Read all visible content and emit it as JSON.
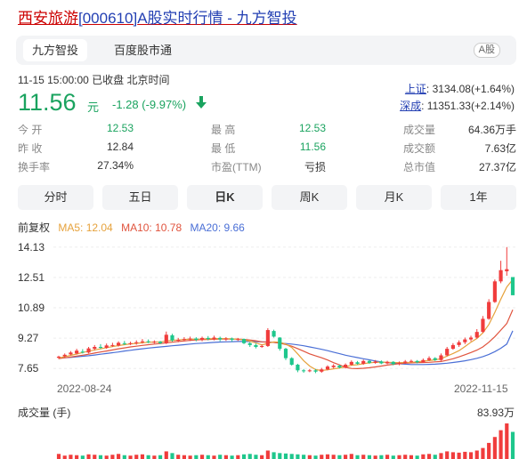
{
  "header": {
    "title_prefix": "西安旅游",
    "title_code": "[000610]",
    "title_suffix": "A股实时行情 - 九方智投"
  },
  "tabs": {
    "items": [
      "九方智投",
      "百度股市通"
    ],
    "active": 0,
    "badge": "A股"
  },
  "quote": {
    "status": "11-15 15:00:00  已收盘  北京时间",
    "price": "11.56",
    "unit": "元",
    "change": "-1.28 (-9.97%)",
    "direction": "down"
  },
  "indices": [
    {
      "name": "上证",
      "value": ": 3134.08(+1.64%)"
    },
    {
      "name": "深成",
      "value": ": 11351.33(+2.14%)"
    }
  ],
  "stats": {
    "col1": [
      {
        "label": "今    开",
        "value": "12.53",
        "green": true
      },
      {
        "label": "昨    收",
        "value": "12.84",
        "green": false
      },
      {
        "label": "换手率",
        "value": "27.34%",
        "green": false
      }
    ],
    "col2": [
      {
        "label": "最    高",
        "value": "12.53",
        "green": true
      },
      {
        "label": "最    低",
        "value": "11.56",
        "green": true
      },
      {
        "label": "市盈(TTM)",
        "value": "亏损",
        "green": false
      }
    ],
    "col3": [
      {
        "label": "成交量",
        "value": "64.36万手",
        "green": false
      },
      {
        "label": "成交额",
        "value": "7.63亿",
        "green": false
      },
      {
        "label": "总市值",
        "value": "27.37亿",
        "green": false
      }
    ]
  },
  "period_tabs": {
    "items": [
      "分时",
      "五日",
      "日K",
      "周K",
      "月K",
      "1年"
    ],
    "active": 2
  },
  "ma_legend": {
    "prefix": "前复权",
    "ma5": "MA5: 12.04",
    "ma10": "MA10: 10.78",
    "ma20": "MA20: 9.66"
  },
  "colors": {
    "up": "#f03c3c",
    "down": "#1ec78c",
    "ma5": "#e6a23c",
    "ma10": "#e0533d",
    "ma20": "#4a6fd6",
    "accent": "#2440b3",
    "title": "#cc0000"
  },
  "chart_data": {
    "type": "candlestick",
    "y_ticks": [
      "14.13",
      "12.51",
      "10.89",
      "9.27",
      "7.65"
    ],
    "ylim": [
      6.9,
      14.5
    ],
    "x_labels": [
      "2022-08-24",
      "2022-11-15"
    ],
    "volume_label": "成交量 (手)",
    "volume_max_label": "83.93万",
    "candles": [
      [
        8.22,
        8.28,
        8.33,
        8.15
      ],
      [
        8.3,
        8.38,
        8.45,
        8.25
      ],
      [
        8.4,
        8.5,
        8.58,
        8.35
      ],
      [
        8.45,
        8.6,
        8.7,
        8.4
      ],
      [
        8.55,
        8.5,
        8.68,
        8.45
      ],
      [
        8.5,
        8.72,
        8.8,
        8.45
      ],
      [
        8.7,
        8.8,
        8.9,
        8.62
      ],
      [
        8.8,
        8.75,
        8.95,
        8.7
      ],
      [
        8.75,
        8.88,
        8.98,
        8.7
      ],
      [
        8.85,
        8.9,
        9.02,
        8.8
      ],
      [
        8.88,
        9.02,
        9.1,
        8.82
      ],
      [
        9.0,
        8.95,
        9.12,
        8.9
      ],
      [
        8.95,
        9.0,
        9.08,
        8.9
      ],
      [
        9.0,
        9.05,
        9.15,
        8.92
      ],
      [
        9.05,
        9.1,
        9.22,
        8.98
      ],
      [
        9.1,
        9.05,
        9.2,
        9.0
      ],
      [
        9.05,
        9.08,
        9.15,
        8.98
      ],
      [
        9.08,
        9.0,
        9.12,
        8.95
      ],
      [
        9.0,
        9.45,
        9.62,
        8.95
      ],
      [
        9.42,
        9.15,
        9.5,
        9.08
      ],
      [
        9.15,
        9.18,
        9.28,
        9.05
      ],
      [
        9.18,
        9.22,
        9.32,
        9.1
      ],
      [
        9.2,
        9.25,
        9.35,
        9.12
      ],
      [
        9.25,
        9.18,
        9.32,
        9.1
      ],
      [
        9.18,
        9.28,
        9.35,
        9.1
      ],
      [
        9.28,
        9.22,
        9.38,
        9.15
      ],
      [
        9.22,
        9.3,
        9.4,
        9.15
      ],
      [
        9.28,
        9.2,
        9.35,
        9.1
      ],
      [
        9.2,
        9.25,
        9.32,
        9.12
      ],
      [
        9.25,
        9.18,
        9.3,
        9.08
      ],
      [
        9.18,
        9.22,
        9.28,
        9.12
      ],
      [
        9.22,
        9.0,
        9.25,
        8.95
      ],
      [
        9.0,
        8.9,
        9.05,
        8.8
      ],
      [
        8.9,
        8.8,
        8.98,
        8.72
      ],
      [
        8.8,
        8.85,
        8.92,
        8.75
      ],
      [
        8.85,
        9.7,
        9.8,
        8.8
      ],
      [
        9.65,
        9.35,
        9.72,
        9.3
      ],
      [
        9.3,
        8.7,
        9.32,
        8.6
      ],
      [
        8.7,
        8.2,
        8.75,
        8.1
      ],
      [
        8.2,
        7.85,
        8.25,
        7.8
      ],
      [
        7.85,
        7.55,
        7.9,
        7.45
      ],
      [
        7.55,
        7.5,
        7.62,
        7.42
      ],
      [
        7.5,
        7.55,
        7.62,
        7.45
      ],
      [
        7.55,
        7.48,
        7.62,
        7.4
      ],
      [
        7.48,
        7.6,
        7.68,
        7.42
      ],
      [
        7.6,
        7.75,
        7.82,
        7.55
      ],
      [
        7.72,
        7.8,
        7.88,
        7.65
      ],
      [
        7.8,
        7.7,
        7.85,
        7.65
      ],
      [
        7.7,
        7.85,
        7.92,
        7.65
      ],
      [
        7.85,
        8.0,
        8.08,
        7.8
      ],
      [
        7.98,
        7.9,
        8.05,
        7.85
      ],
      [
        7.9,
        8.05,
        8.12,
        7.85
      ],
      [
        8.05,
        7.95,
        8.1,
        7.9
      ],
      [
        7.95,
        8.02,
        8.1,
        7.9
      ],
      [
        8.02,
        7.92,
        8.08,
        7.88
      ],
      [
        7.92,
        8.0,
        8.06,
        7.88
      ],
      [
        8.0,
        7.88,
        8.04,
        7.82
      ],
      [
        7.88,
        7.95,
        8.02,
        7.82
      ],
      [
        7.95,
        8.02,
        8.1,
        7.9
      ],
      [
        8.02,
        8.05,
        8.12,
        7.95
      ],
      [
        8.05,
        7.98,
        8.1,
        7.92
      ],
      [
        7.98,
        8.1,
        8.18,
        7.95
      ],
      [
        8.1,
        8.2,
        8.3,
        8.05
      ],
      [
        8.2,
        8.1,
        8.25,
        8.05
      ],
      [
        8.1,
        8.35,
        8.45,
        8.05
      ],
      [
        8.35,
        8.7,
        8.8,
        8.3
      ],
      [
        8.7,
        8.9,
        9.0,
        8.65
      ],
      [
        8.9,
        9.05,
        9.15,
        8.8
      ],
      [
        9.05,
        9.2,
        9.3,
        8.95
      ],
      [
        9.2,
        9.3,
        9.4,
        9.1
      ],
      [
        9.3,
        9.6,
        9.75,
        9.25
      ],
      [
        9.6,
        10.3,
        10.45,
        9.55
      ],
      [
        10.3,
        11.2,
        11.35,
        10.25
      ],
      [
        11.2,
        12.3,
        12.4,
        11.15
      ],
      [
        12.3,
        12.9,
        13.4,
        12.2
      ],
      [
        12.84,
        12.95,
        14.13,
        12.6
      ],
      [
        12.53,
        11.56,
        12.53,
        11.56
      ]
    ],
    "ma5": [
      8.2,
      8.28,
      8.35,
      8.42,
      8.5,
      8.57,
      8.64,
      8.7,
      8.76,
      8.82,
      8.87,
      8.92,
      8.96,
      8.99,
      9.02,
      9.05,
      9.06,
      9.06,
      9.12,
      9.15,
      9.17,
      9.2,
      9.22,
      9.21,
      9.22,
      9.23,
      9.24,
      9.25,
      9.24,
      9.23,
      9.21,
      9.17,
      9.11,
      9.02,
      8.91,
      8.99,
      9.07,
      9.05,
      8.95,
      8.77,
      8.43,
      8.07,
      7.78,
      7.59,
      7.54,
      7.58,
      7.63,
      7.67,
      7.73,
      7.82,
      7.85,
      7.9,
      7.95,
      7.98,
      7.99,
      7.98,
      7.97,
      7.96,
      7.97,
      7.98,
      8.0,
      8.04,
      8.07,
      8.11,
      8.17,
      8.31,
      8.45,
      8.6,
      8.82,
      9.05,
      9.25,
      9.55,
      10.0,
      10.65,
      11.35,
      12.0,
      12.4
    ],
    "ma10": [
      8.18,
      8.22,
      8.26,
      8.31,
      8.36,
      8.41,
      8.47,
      8.53,
      8.58,
      8.64,
      8.7,
      8.75,
      8.8,
      8.84,
      8.88,
      8.92,
      8.95,
      8.98,
      9.02,
      9.05,
      9.09,
      9.12,
      9.15,
      9.17,
      9.19,
      9.2,
      9.21,
      9.22,
      9.22,
      9.22,
      9.22,
      9.2,
      9.17,
      9.13,
      9.07,
      9.05,
      9.04,
      9.0,
      8.93,
      8.84,
      8.71,
      8.57,
      8.43,
      8.32,
      8.22,
      8.1,
      7.96,
      7.84,
      7.71,
      7.65,
      7.64,
      7.66,
      7.69,
      7.73,
      7.78,
      7.83,
      7.87,
      7.9,
      7.93,
      7.95,
      7.96,
      7.97,
      7.98,
      8.0,
      8.02,
      8.09,
      8.17,
      8.27,
      8.38,
      8.5,
      8.63,
      8.8,
      9.05,
      9.35,
      9.7,
      10.05,
      10.78
    ],
    "ma20": [
      8.2,
      8.22,
      8.24,
      8.27,
      8.3,
      8.33,
      8.37,
      8.41,
      8.45,
      8.49,
      8.53,
      8.58,
      8.62,
      8.66,
      8.7,
      8.74,
      8.77,
      8.8,
      8.83,
      8.86,
      8.89,
      8.92,
      8.95,
      8.98,
      9.0,
      9.02,
      9.04,
      9.06,
      9.07,
      9.08,
      9.09,
      9.09,
      9.09,
      9.08,
      9.07,
      9.06,
      9.04,
      9.01,
      8.98,
      8.95,
      8.91,
      8.86,
      8.8,
      8.74,
      8.67,
      8.6,
      8.52,
      8.44,
      8.36,
      8.29,
      8.23,
      8.17,
      8.11,
      8.05,
      8.0,
      7.96,
      7.93,
      7.9,
      7.88,
      7.86,
      7.86,
      7.86,
      7.87,
      7.88,
      7.9,
      7.93,
      7.97,
      8.01,
      8.06,
      8.12,
      8.19,
      8.28,
      8.4,
      8.55,
      8.73,
      8.95,
      9.66
    ],
    "volumes": [
      12,
      8,
      10,
      9,
      8,
      11,
      10,
      9,
      8,
      10,
      12,
      9,
      8,
      10,
      11,
      9,
      8,
      9,
      18,
      14,
      10,
      9,
      8,
      9,
      10,
      9,
      8,
      10,
      9,
      8,
      9,
      11,
      12,
      10,
      9,
      20,
      16,
      14,
      13,
      12,
      11,
      10,
      9,
      8,
      10,
      11,
      10,
      9,
      10,
      12,
      9,
      10,
      9,
      8,
      9,
      10,
      8,
      9,
      10,
      9,
      8,
      11,
      12,
      10,
      14,
      18,
      16,
      15,
      17,
      16,
      20,
      26,
      38,
      52,
      68,
      84,
      64
    ]
  }
}
